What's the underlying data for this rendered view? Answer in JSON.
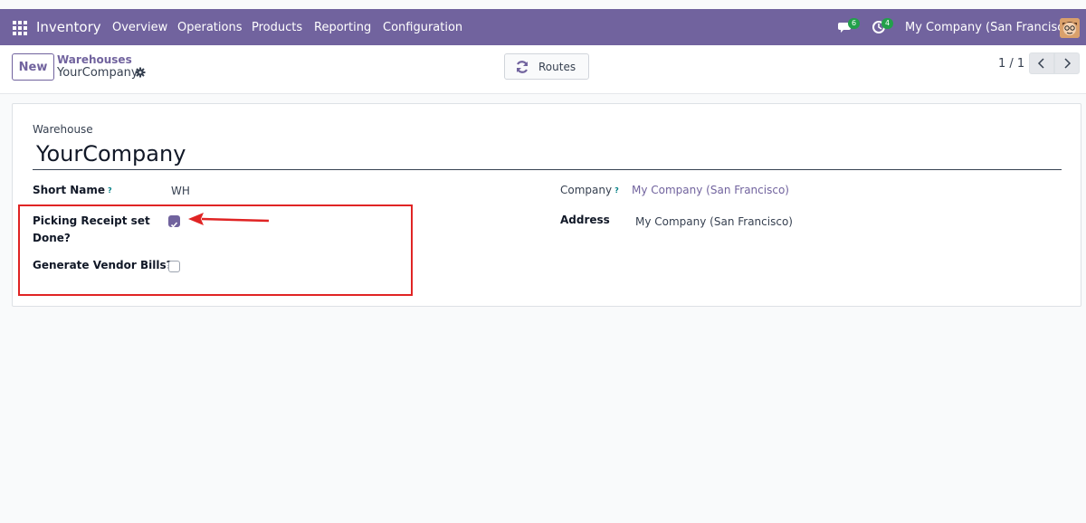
{
  "topbar": {
    "app_name": "Inventory",
    "menu": [
      "Overview",
      "Operations",
      "Products",
      "Reporting",
      "Configuration"
    ],
    "messages_count": "6",
    "activities_count": "4",
    "company": "My Company (San Francisco)"
  },
  "control": {
    "new_label": "New",
    "breadcrumb_parent": "Warehouses",
    "breadcrumb_current": "YourCompany",
    "routes_label": "Routes",
    "pager": "1 / 1"
  },
  "form": {
    "warehouse_label": "Warehouse",
    "warehouse_name": "YourCompany",
    "short_name_label": "Short Name",
    "short_name_value": "WH",
    "help_mark": "?",
    "picking_label": "Picking Receipt set Done?",
    "picking_checked": true,
    "vendor_bills_label": "Generate Vendor Bills?",
    "vendor_bills_checked": false,
    "company_label": "Company",
    "company_value": "My Company (San Francisco)",
    "address_label": "Address",
    "address_value": "My Company (San Francisco)"
  },
  "colors": {
    "brand": "#71639e",
    "annotation": "#e02424",
    "badge": "#22a04a"
  }
}
